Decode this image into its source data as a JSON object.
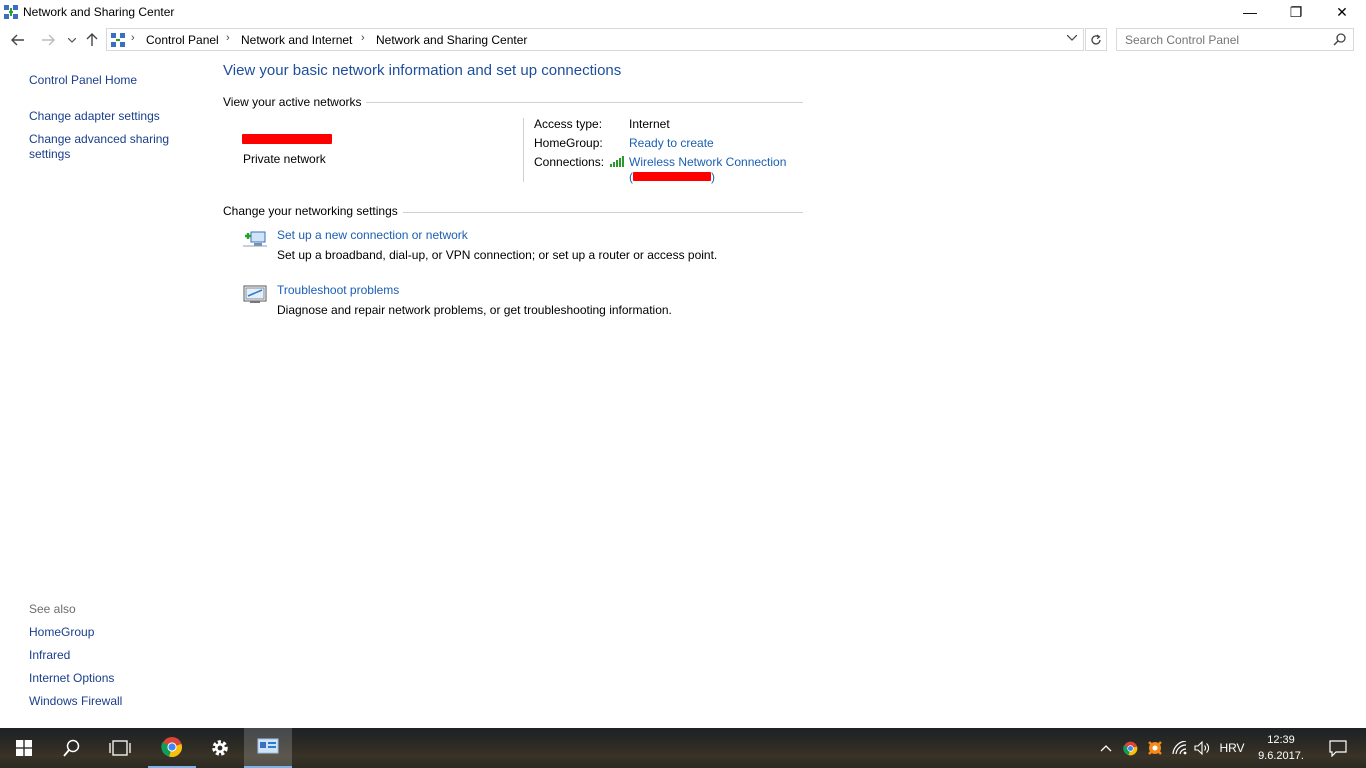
{
  "window": {
    "title": "Network and Sharing Center",
    "minimize_glyph": "—",
    "maximize_glyph": "❐",
    "close_glyph": "✕"
  },
  "address_bar": {
    "crumbs": [
      "Control Panel",
      "Network and Internet",
      "Network and Sharing Center"
    ],
    "separator": "›",
    "search_placeholder": "Search Control Panel"
  },
  "left_pane": {
    "links": [
      "Control Panel Home",
      "Change adapter settings",
      "Change advanced sharing",
      "settings"
    ],
    "see_also_label": "See also",
    "see_also": [
      "HomeGroup",
      "Infrared",
      "Internet Options",
      "Windows Firewall"
    ]
  },
  "main": {
    "page_title": "View your basic network information and set up connections",
    "active_networks_heading": "View your active networks",
    "network_type": "Private network",
    "details": {
      "access_type_label": "Access type:",
      "access_type_value": "Internet",
      "homegroup_label": "HomeGroup:",
      "homegroup_value": "Ready to create",
      "connections_label": "Connections:",
      "connections_value": "Wireless Network Connection"
    },
    "change_settings_heading": "Change your networking settings",
    "tasks": [
      {
        "link": "Set up a new connection or network",
        "desc": "Set up a broadband, dial-up, or VPN connection; or set up a router or access point."
      },
      {
        "link": "Troubleshoot problems",
        "desc": "Diagnose and repair network problems, or get troubleshooting information."
      }
    ]
  },
  "taskbar": {
    "language": "HRV",
    "time": "12:39",
    "date": "9.6.2017."
  },
  "colors": {
    "link": "#1a5fb4",
    "title": "#1e4e9e",
    "redaction": "#ff0000"
  }
}
